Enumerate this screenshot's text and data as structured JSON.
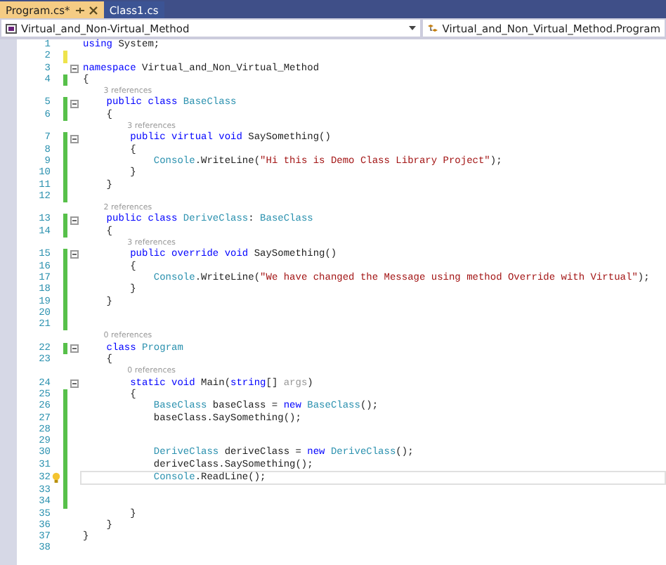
{
  "tabs": [
    {
      "label": "Program.cs*",
      "selected": true,
      "pinned": true,
      "closable": true
    },
    {
      "label": "Class1.cs",
      "selected": false,
      "pinned": false,
      "closable": false
    }
  ],
  "navigation": {
    "project": "Virtual_and_Non-Virtual_Method",
    "class": "Virtual_and_Non_Virtual_Method.Program"
  },
  "editor": {
    "rows": [
      {
        "kind": "code",
        "number": "1",
        "fold": false,
        "current": false,
        "bulb": false,
        "tokens": [
          {
            "kind": "keyword",
            "text": "using "
          },
          {
            "kind": "plain",
            "text": "System;"
          }
        ]
      },
      {
        "kind": "code",
        "number": "2",
        "color": "#eee34c",
        "fold": false,
        "current": false,
        "bulb": false
      },
      {
        "kind": "code",
        "number": "3",
        "fold": true,
        "current": false,
        "bulb": false,
        "tokens": [
          {
            "kind": "keyword",
            "text": "namespace "
          },
          {
            "kind": "plain",
            "text": "Virtual_and_Non_Virtual_Method"
          }
        ]
      },
      {
        "kind": "code",
        "number": "4",
        "color": "#57c04a",
        "fold": false,
        "current": false,
        "bulb": false,
        "tokens": [
          {
            "kind": "plain",
            "text": "{"
          }
        ]
      },
      {
        "kind": "lens",
        "text": "3 references"
      },
      {
        "kind": "code",
        "number": "5",
        "color": "#57c04a",
        "fold": true,
        "current": false,
        "bulb": false,
        "tokens": [
          {
            "kind": "keyword",
            "text": "    public class "
          },
          {
            "kind": "type",
            "text": "BaseClass"
          }
        ]
      },
      {
        "kind": "code",
        "number": "6",
        "color": "#57c04a",
        "fold": false,
        "current": false,
        "bulb": false,
        "tokens": [
          {
            "kind": "plain",
            "text": "    {"
          }
        ]
      },
      {
        "kind": "lens",
        "text": "3 references"
      },
      {
        "kind": "code",
        "number": "7",
        "color": "#57c04a",
        "fold": true,
        "current": false,
        "bulb": false,
        "tokens": [
          {
            "kind": "keyword",
            "text": "        public virtual void "
          },
          {
            "kind": "plain",
            "text": "SaySomething()"
          }
        ]
      },
      {
        "kind": "code",
        "number": "8",
        "color": "#57c04a",
        "fold": false,
        "current": false,
        "bulb": false,
        "tokens": [
          {
            "kind": "plain",
            "text": "        {"
          }
        ]
      },
      {
        "kind": "code",
        "number": "9",
        "color": "#57c04a",
        "fold": false,
        "current": false,
        "bulb": false,
        "tokens": [
          {
            "kind": "type",
            "text": "            Console"
          },
          {
            "kind": "plain",
            "text": ".WriteLine("
          },
          {
            "kind": "string",
            "text": "\"Hi this is Demo Class Library Project\""
          },
          {
            "kind": "plain",
            "text": ");"
          }
        ]
      },
      {
        "kind": "code",
        "number": "10",
        "color": "#57c04a",
        "fold": false,
        "current": false,
        "bulb": false,
        "tokens": [
          {
            "kind": "plain",
            "text": "        }"
          }
        ]
      },
      {
        "kind": "code",
        "number": "11",
        "color": "#57c04a",
        "fold": false,
        "current": false,
        "bulb": false,
        "tokens": [
          {
            "kind": "plain",
            "text": "    }"
          }
        ]
      },
      {
        "kind": "code",
        "number": "12",
        "color": "#57c04a",
        "fold": false,
        "current": false,
        "bulb": false
      },
      {
        "kind": "lens",
        "text": "2 references"
      },
      {
        "kind": "code",
        "number": "13",
        "color": "#57c04a",
        "fold": true,
        "current": false,
        "bulb": false,
        "tokens": [
          {
            "kind": "keyword",
            "text": "    public class "
          },
          {
            "kind": "type",
            "text": "DeriveClass"
          },
          {
            "kind": "plain",
            "text": ": "
          },
          {
            "kind": "type",
            "text": "BaseClass"
          }
        ]
      },
      {
        "kind": "code",
        "number": "14",
        "color": "#57c04a",
        "fold": false,
        "current": false,
        "bulb": false,
        "tokens": [
          {
            "kind": "plain",
            "text": "    {"
          }
        ]
      },
      {
        "kind": "lens",
        "text": "3 references"
      },
      {
        "kind": "code",
        "number": "15",
        "color": "#57c04a",
        "fold": true,
        "current": false,
        "bulb": false,
        "tokens": [
          {
            "kind": "keyword",
            "text": "        public override void "
          },
          {
            "kind": "plain",
            "text": "SaySomething()"
          }
        ]
      },
      {
        "kind": "code",
        "number": "16",
        "color": "#57c04a",
        "fold": false,
        "current": false,
        "bulb": false,
        "tokens": [
          {
            "kind": "plain",
            "text": "        {"
          }
        ]
      },
      {
        "kind": "code",
        "number": "17",
        "color": "#57c04a",
        "fold": false,
        "current": false,
        "bulb": false,
        "tokens": [
          {
            "kind": "type",
            "text": "            Console"
          },
          {
            "kind": "plain",
            "text": ".WriteLine("
          },
          {
            "kind": "string",
            "text": "\"We have changed the Message using method Override with Virtual\""
          },
          {
            "kind": "plain",
            "text": ");"
          }
        ]
      },
      {
        "kind": "code",
        "number": "18",
        "color": "#57c04a",
        "fold": false,
        "current": false,
        "bulb": false,
        "tokens": [
          {
            "kind": "plain",
            "text": "        }"
          }
        ]
      },
      {
        "kind": "code",
        "number": "19",
        "color": "#57c04a",
        "fold": false,
        "current": false,
        "bulb": false,
        "tokens": [
          {
            "kind": "plain",
            "text": "    }"
          }
        ]
      },
      {
        "kind": "code",
        "number": "20",
        "color": "#57c04a",
        "fold": false,
        "current": false,
        "bulb": false
      },
      {
        "kind": "code",
        "number": "21",
        "color": "#57c04a",
        "fold": false,
        "current": false,
        "bulb": false
      },
      {
        "kind": "lens",
        "text": "0 references"
      },
      {
        "kind": "code",
        "number": "22",
        "color": "#57c04a",
        "fold": true,
        "current": false,
        "bulb": false,
        "tokens": [
          {
            "kind": "keyword",
            "text": "    class "
          },
          {
            "kind": "type",
            "text": "Program"
          }
        ]
      },
      {
        "kind": "code",
        "number": "23",
        "fold": false,
        "current": false,
        "bulb": false,
        "tokens": [
          {
            "kind": "plain",
            "text": "    {"
          }
        ]
      },
      {
        "kind": "lens",
        "text": "0 references"
      },
      {
        "kind": "code",
        "number": "24",
        "fold": true,
        "current": false,
        "bulb": false,
        "tokens": [
          {
            "kind": "keyword",
            "text": "        static void "
          },
          {
            "kind": "plain",
            "text": "Main("
          },
          {
            "kind": "keyword",
            "text": "string"
          },
          {
            "kind": "plain",
            "text": "[] "
          },
          {
            "kind": "unused",
            "text": "args"
          },
          {
            "kind": "plain",
            "text": ")"
          }
        ]
      },
      {
        "kind": "code",
        "number": "25",
        "color": "#57c04a",
        "fold": false,
        "current": false,
        "bulb": false,
        "tokens": [
          {
            "kind": "plain",
            "text": "        {"
          }
        ]
      },
      {
        "kind": "code",
        "number": "26",
        "color": "#57c04a",
        "fold": false,
        "current": false,
        "bulb": false,
        "tokens": [
          {
            "kind": "type",
            "text": "            BaseClass "
          },
          {
            "kind": "plain",
            "text": "baseClass = "
          },
          {
            "kind": "keyword",
            "text": "new "
          },
          {
            "kind": "type",
            "text": "BaseClass"
          },
          {
            "kind": "plain",
            "text": "();"
          }
        ]
      },
      {
        "kind": "code",
        "number": "27",
        "color": "#57c04a",
        "fold": false,
        "current": false,
        "bulb": false,
        "tokens": [
          {
            "kind": "plain",
            "text": "            baseClass.SaySomething();"
          }
        ]
      },
      {
        "kind": "code",
        "number": "28",
        "color": "#57c04a",
        "fold": false,
        "current": false,
        "bulb": false
      },
      {
        "kind": "code",
        "number": "29",
        "color": "#57c04a",
        "fold": false,
        "current": false,
        "bulb": false
      },
      {
        "kind": "code",
        "number": "30",
        "color": "#57c04a",
        "fold": false,
        "current": false,
        "bulb": false,
        "tokens": [
          {
            "kind": "type",
            "text": "            DeriveClass "
          },
          {
            "kind": "plain",
            "text": "deriveClass = "
          },
          {
            "kind": "keyword",
            "text": "new "
          },
          {
            "kind": "type",
            "text": "DeriveClass"
          },
          {
            "kind": "plain",
            "text": "();"
          }
        ]
      },
      {
        "kind": "code",
        "number": "31",
        "color": "#57c04a",
        "fold": false,
        "current": false,
        "bulb": false,
        "tokens": [
          {
            "kind": "plain",
            "text": "            deriveClass.SaySomething();"
          }
        ]
      },
      {
        "kind": "code",
        "number": "32",
        "color": "#57c04a",
        "fold": false,
        "current": true,
        "bulb": true,
        "tokens": [
          {
            "kind": "type",
            "text": "            Console"
          },
          {
            "kind": "plain",
            "text": ".ReadLine();"
          }
        ]
      },
      {
        "kind": "code",
        "number": "33",
        "color": "#57c04a",
        "fold": false,
        "current": false,
        "bulb": false
      },
      {
        "kind": "code",
        "number": "34",
        "color": "#57c04a",
        "fold": false,
        "current": false,
        "bulb": false
      },
      {
        "kind": "code",
        "number": "35",
        "fold": false,
        "current": false,
        "bulb": false,
        "tokens": [
          {
            "kind": "plain",
            "text": "        }"
          }
        ]
      },
      {
        "kind": "code",
        "number": "36",
        "fold": false,
        "current": false,
        "bulb": false,
        "tokens": [
          {
            "kind": "plain",
            "text": "    }"
          }
        ]
      },
      {
        "kind": "code",
        "number": "37",
        "fold": false,
        "current": false,
        "bulb": false,
        "tokens": [
          {
            "kind": "plain",
            "text": "}"
          }
        ]
      },
      {
        "kind": "code",
        "number": "38",
        "fold": false,
        "current": false,
        "bulb": false
      }
    ]
  }
}
